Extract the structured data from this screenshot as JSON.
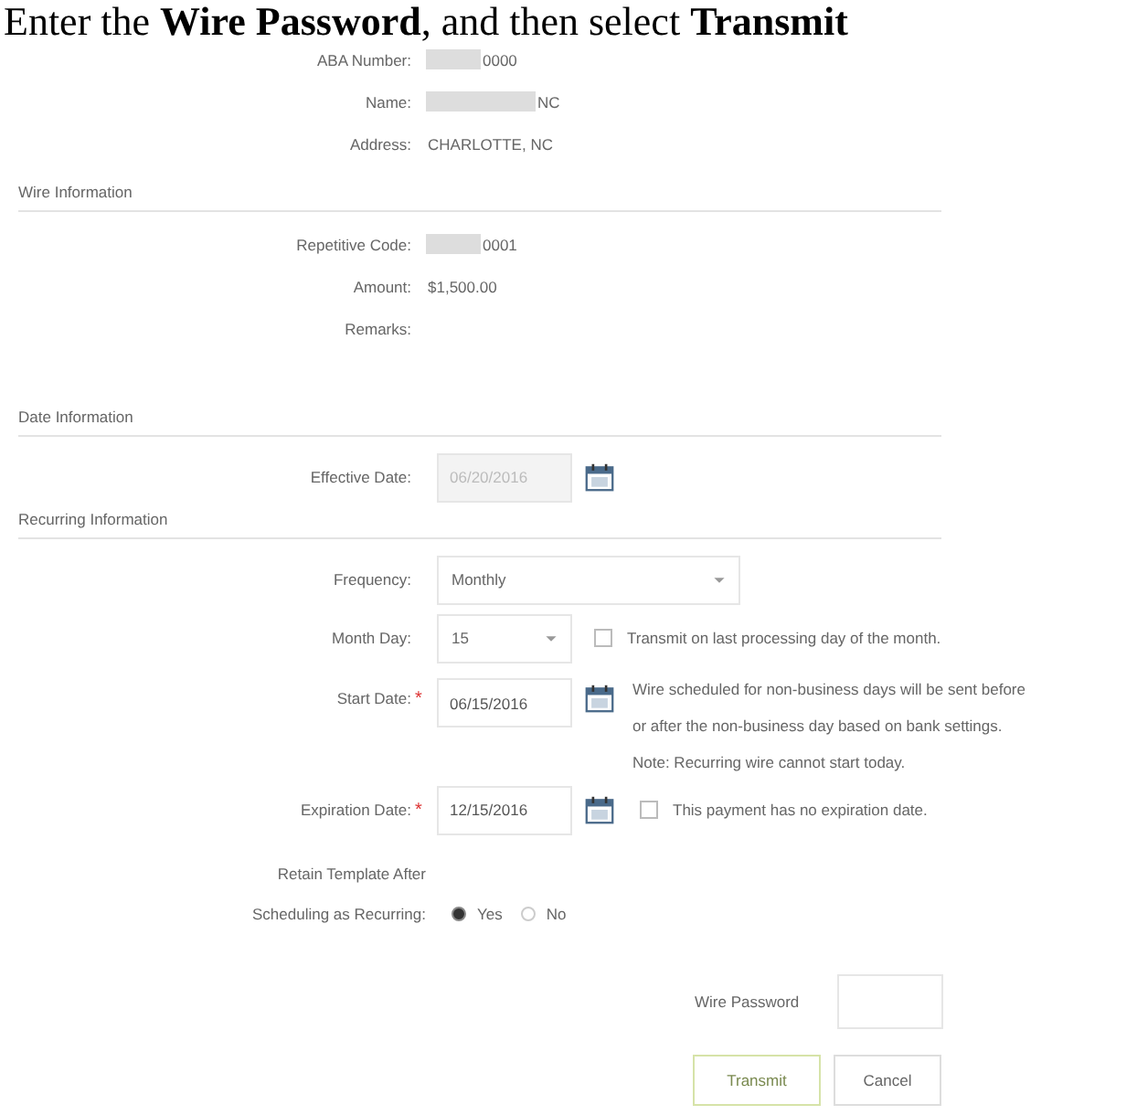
{
  "instruction": "Enter the **Wire Password**, and then select **Transmit**",
  "beneficiary": [
    {
      "label": "ABA Number:",
      "value": "0000",
      "redacted": true
    },
    {
      "label": "Name:",
      "value": "NC",
      "redacted": true
    },
    {
      "label": "Address:",
      "value": "CHARLOTTE, NC"
    }
  ],
  "sections": [
    {
      "title": "Wire Information",
      "fields": [
        {
          "kind": "text",
          "label": "Repetitive Code:",
          "value": "0001",
          "redacted": true
        },
        {
          "kind": "text",
          "label": "Amount:",
          "value": "$1,500.00"
        },
        {
          "kind": "text",
          "label": "Remarks:"
        }
      ]
    },
    {
      "title": "Date Information",
      "fields": [
        {
          "kind": "date",
          "label": "Effective Date:",
          "value": "06/20/2016",
          "disabled": true
        }
      ]
    },
    {
      "title": "Recurring Information",
      "fields": [
        {
          "kind": "select",
          "label": "Frequency:",
          "value": "Monthly"
        },
        {
          "kind": "select",
          "label": "Month Day:",
          "value": "15",
          "checkbox": {
            "label": "Transmit on last processing day of the month.",
            "checked": false
          }
        },
        {
          "kind": "date",
          "label": "Start Date:",
          "value": "06/15/2016",
          "disabled": false,
          "required_mark": "*",
          "notes": [
            "Wire scheduled for non-business days will be sent before",
            "or after the non-business day based on bank settings.",
            "Note: Recurring wire cannot start today."
          ]
        },
        {
          "kind": "date",
          "label": "Expiration Date:",
          "value": "12/15/2016",
          "disabled": false,
          "required_mark": "*",
          "checkbox": {
            "label": "This payment has no expiration date.",
            "checked": false
          }
        },
        {
          "kind": "radio",
          "label_lines": [
            "Retain Template After",
            "Scheduling as Recurring:"
          ],
          "options": [
            {
              "label": "Yes",
              "selected": true
            },
            {
              "label": "No",
              "selected": false
            }
          ]
        }
      ]
    }
  ],
  "password": {
    "label": "Wire Password"
  },
  "buttons": [
    {
      "label": "Transmit",
      "kind": "primary"
    },
    {
      "label": "Cancel",
      "kind": "default"
    }
  ]
}
